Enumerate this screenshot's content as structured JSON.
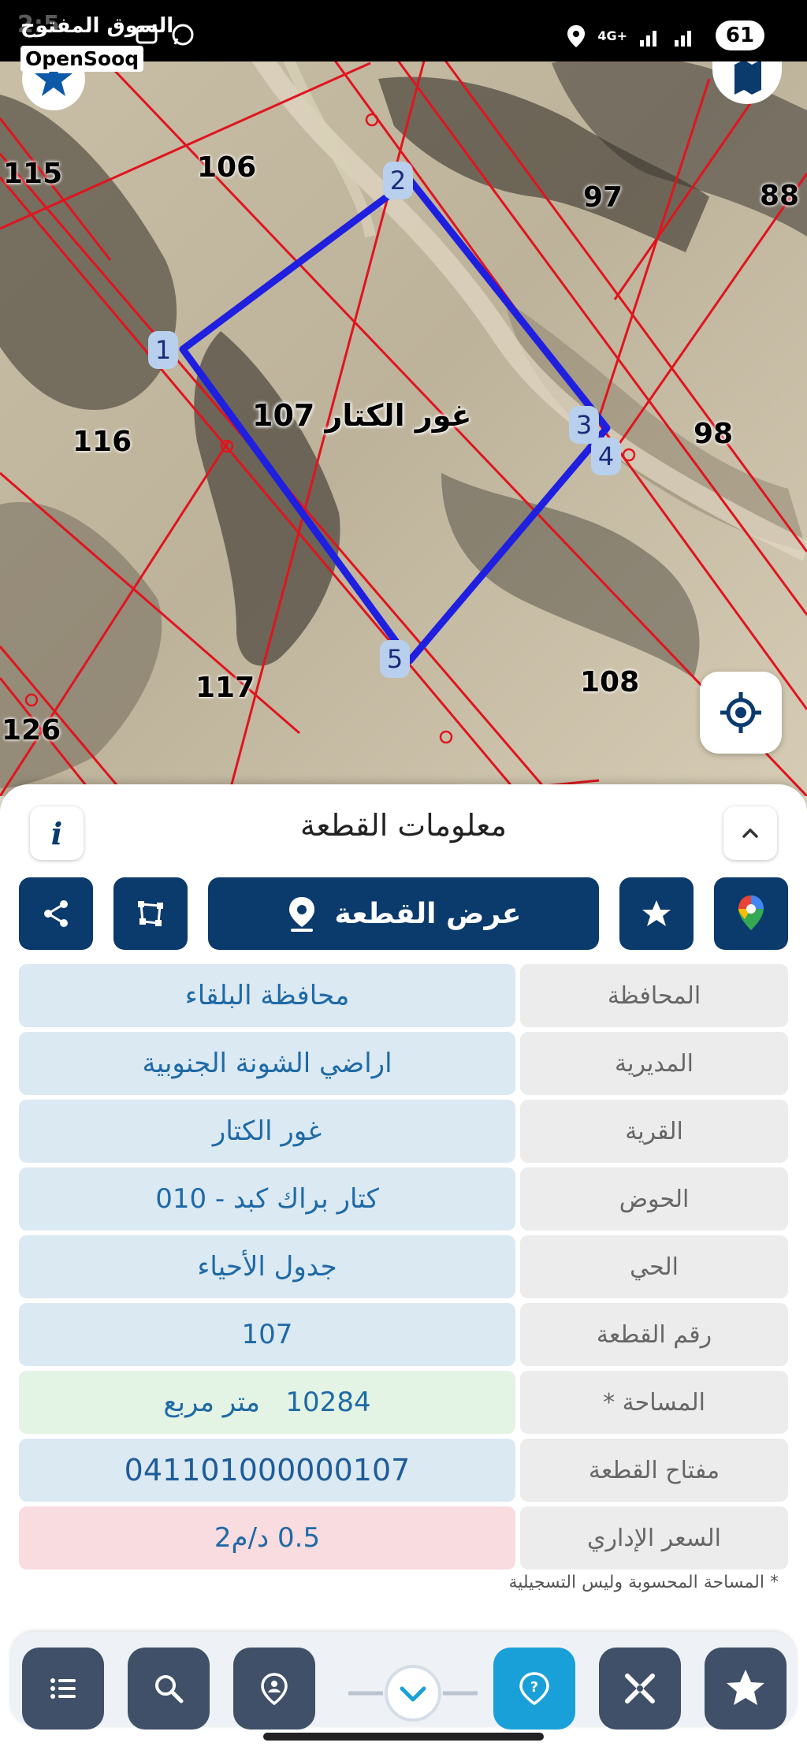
{
  "statusbar": {
    "time_partial": "2:5",
    "battery": "61",
    "network": "4G+",
    "watermark_ar": "السوق المفتوح",
    "watermark_en": "OpenSooq"
  },
  "map": {
    "parcel_label": "غور الكتار 107",
    "vertex_labels": [
      "1",
      "2",
      "3",
      "4",
      "5"
    ],
    "neighbor_parcels": [
      "115",
      "106",
      "97",
      "88",
      "116",
      "98",
      "117",
      "108",
      "126"
    ]
  },
  "panel": {
    "title": "معلومات القطعة",
    "info_icon": "i",
    "show_parcel_label": "عرض القطعة",
    "rows": [
      {
        "label": "المحافظة",
        "value": "محافظة البلقاء"
      },
      {
        "label": "المديرية",
        "value": "اراضي الشونة الجنوبية"
      },
      {
        "label": "القرية",
        "value": "غور الكتار"
      },
      {
        "label": "الحوض",
        "value": "كتار براك كبد - 010"
      },
      {
        "label": "الحي",
        "value": "جدول الأحياء"
      },
      {
        "label": "رقم القطعة",
        "value": "107"
      },
      {
        "label": "المساحة *",
        "value": "10284   متر مربع"
      },
      {
        "label": "مفتاح القطعة",
        "value": "041101000000107"
      },
      {
        "label": "السعر الإداري",
        "value": "0.5 د/م2"
      }
    ],
    "footnote": "* المساحة المحسوبة وليس التسجيلية"
  },
  "colors": {
    "navy": "#0b3a6c",
    "parcel_outline": "#1f1fe0",
    "grid_lines": "#e0141e",
    "active_nav": "#1aa0d8"
  },
  "icons": [
    "share-icon",
    "polygon-icon",
    "pin-icon",
    "star-icon",
    "google-maps-icon",
    "list-icon",
    "search-icon",
    "location-person-icon",
    "chevron-down-icon",
    "help-icon",
    "measure-icon",
    "favorite-icon",
    "crosshair-icon",
    "map-layers-icon"
  ]
}
